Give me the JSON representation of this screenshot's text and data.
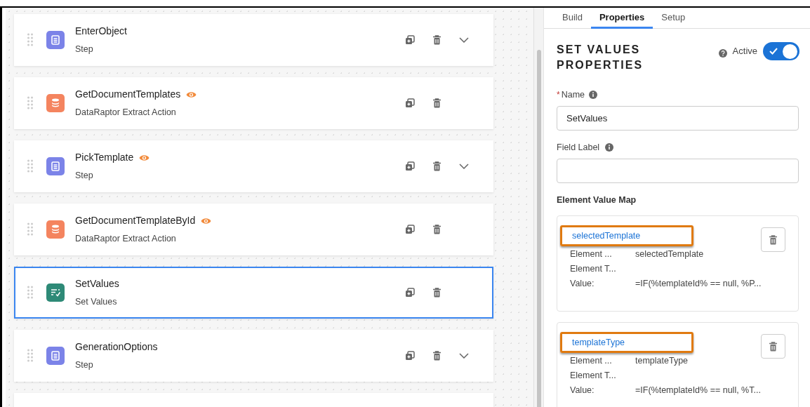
{
  "steps": [
    {
      "name": "EnterObject",
      "type": "Step",
      "kind": "step",
      "preview": false,
      "expandable": true,
      "selected": false
    },
    {
      "name": "GetDocumentTemplates",
      "type": "DataRaptor Extract Action",
      "kind": "extract",
      "preview": true,
      "expandable": false,
      "selected": false
    },
    {
      "name": "PickTemplate",
      "type": "Step",
      "kind": "step",
      "preview": true,
      "expandable": true,
      "selected": false
    },
    {
      "name": "GetDocumentTemplateById",
      "type": "DataRaptor Extract Action",
      "kind": "extract",
      "preview": true,
      "expandable": false,
      "selected": false
    },
    {
      "name": "SetValues",
      "type": "Set Values",
      "kind": "set_values",
      "preview": false,
      "expandable": false,
      "selected": true
    },
    {
      "name": "GenerationOptions",
      "type": "Step",
      "kind": "step",
      "preview": false,
      "expandable": true,
      "selected": false
    }
  ],
  "panel": {
    "tabs": [
      {
        "label": "Build",
        "selected": false
      },
      {
        "label": "Properties",
        "selected": true
      },
      {
        "label": "Setup",
        "selected": false
      }
    ],
    "title": "SET VALUES PROPERTIES",
    "active_label": "Active",
    "active": true,
    "required_mark": "*",
    "name_label": "Name",
    "name_value": "SetValues",
    "field_label": "Field Label",
    "map_heading": "Element Value Map",
    "map_entries": [
      {
        "title": "selectedTemplate",
        "highlighted": true,
        "rows": [
          [
            "Element ...",
            "selectedTemplate"
          ],
          [
            "Element T...",
            ""
          ],
          [
            "Value:",
            "=IF(%templateId% == null, %P..."
          ]
        ]
      },
      {
        "title": "templateType",
        "highlighted": true,
        "rows": [
          [
            "Element ...",
            "templateType"
          ],
          [
            "Element T...",
            ""
          ],
          [
            "Value:",
            "=IF(%templateId% == null, %T..."
          ]
        ]
      }
    ]
  }
}
